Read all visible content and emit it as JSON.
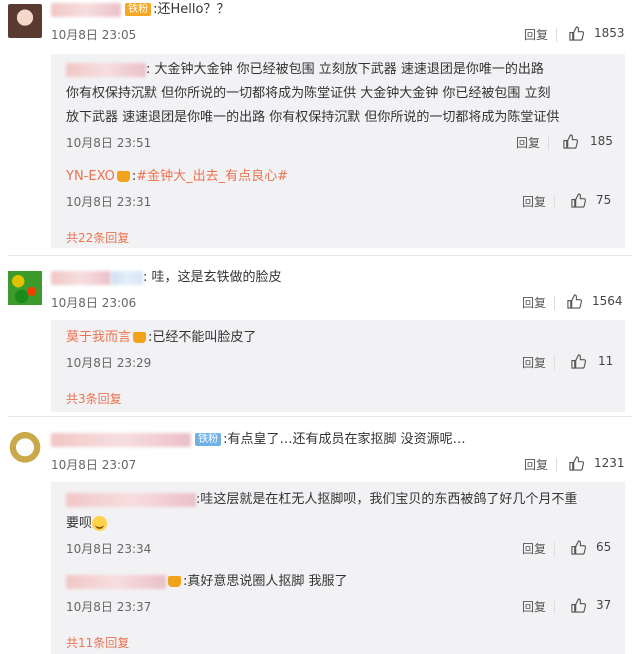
{
  "labels": {
    "reply": "回复",
    "colon": ":"
  },
  "comments": [
    {
      "badge": "铁粉",
      "text": "还Hello？？",
      "time": "10月8日 23:05",
      "likes": "1853",
      "replies": [
        {
          "lines": [
            "大金钟大金钟 你已经被包围 立刻放下武器 速速退团是你唯一的出路",
            "你有权保持沉默 但你所说的一切都将成为陈堂证供 大金钟大金钟 你已经被包围 立刻",
            "放下武器 速速退团是你唯一的出路 你有权保持沉默 但你所说的一切都将成为陈堂证供"
          ],
          "time": "10月8日 23:51",
          "likes": "185"
        },
        {
          "user": "YN-EXO",
          "text": "#金钟大_出去_有点良心#",
          "time": "10月8日 23:31",
          "likes": "75"
        }
      ],
      "more": "共22条回复"
    },
    {
      "text": "哇，这是玄铁做的脸皮",
      "time": "10月8日 23:06",
      "likes": "1564",
      "replies": [
        {
          "user": "莫于我而言",
          "text": "已经不能叫脸皮了",
          "time": "10月8日 23:29",
          "likes": "11"
        }
      ],
      "more": "共3条回复"
    },
    {
      "badge": "铁粉",
      "text": "有点皇了…还有成员在家抠脚 没资源呢…",
      "time": "10月8日 23:07",
      "likes": "1231",
      "replies": [
        {
          "text": "哇这层就是在杠无人抠脚呗，我们宝贝的东西被鸽了好几个月不重",
          "text2": "要呗",
          "time": "10月8日 23:34",
          "likes": "65"
        },
        {
          "text": "真好意思说圈人抠脚 我服了",
          "time": "10月8日 23:37",
          "likes": "37"
        }
      ],
      "more": "共11条回复"
    }
  ],
  "colors": {
    "link": "#eb7350",
    "subbox": "#f2f2f5"
  }
}
